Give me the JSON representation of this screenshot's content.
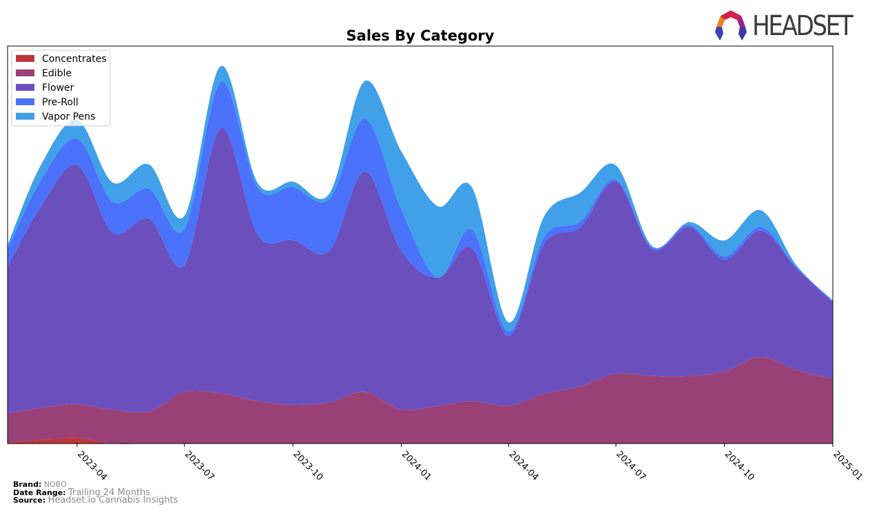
{
  "logo": {
    "text": "HEADSET"
  },
  "footer": {
    "brand_label": "Brand:",
    "brand_value": "NOBO",
    "range_label": "Date Range:",
    "range_value": "Trailing 24 Months",
    "source_label": "Source:",
    "source_value": "Headset.io Cannabis Insights"
  },
  "chart_data": {
    "type": "area",
    "stacked": true,
    "smoothed": true,
    "title": "Sales By Category",
    "xlabel": "",
    "ylabel": "",
    "y_axis_visible": false,
    "ylim": [
      0,
      100
    ],
    "grid": false,
    "legend_position": "top-left",
    "x": [
      "2023-02",
      "2023-03",
      "2023-04",
      "2023-05",
      "2023-06",
      "2023-07",
      "2023-08",
      "2023-09",
      "2023-10",
      "2023-11",
      "2023-12",
      "2024-01",
      "2024-02",
      "2024-03",
      "2024-04",
      "2024-05",
      "2024-06",
      "2024-07",
      "2024-08",
      "2024-09",
      "2024-10",
      "2024-11",
      "2024-12",
      "2025-01"
    ],
    "x_ticks": [
      "2023-04",
      "2023-07",
      "2023-10",
      "2024-01",
      "2024-04",
      "2024-07",
      "2024-10",
      "2025-01"
    ],
    "series": [
      {
        "name": "Concentrates",
        "color": "#c0353a",
        "values": [
          0.2,
          0.9,
          1.4,
          0,
          0,
          0,
          0,
          0,
          0,
          0,
          0,
          0,
          0,
          0,
          0,
          0,
          0,
          0,
          0,
          0,
          0,
          0,
          0,
          0
        ]
      },
      {
        "name": "Edible",
        "color": "#9a4177",
        "values": [
          7.4,
          8.1,
          8.5,
          8.5,
          8.1,
          13.0,
          12.6,
          10.7,
          9.7,
          10.4,
          13.0,
          8.6,
          9.5,
          10.7,
          9.5,
          12.5,
          14.4,
          17.6,
          17.0,
          17.0,
          18.2,
          21.8,
          18.5,
          16.3
        ]
      },
      {
        "name": "Flower",
        "color": "#6a4fbd",
        "values": [
          36.9,
          50.5,
          60.2,
          44.6,
          48.4,
          32.0,
          66.8,
          41.9,
          41.5,
          38.1,
          55.4,
          39.8,
          32.2,
          38.4,
          17.6,
          37.7,
          40.1,
          48.3,
          31.8,
          37.5,
          28.0,
          31.8,
          25.6,
          19.2
        ]
      },
      {
        "name": "Pre-Roll",
        "color": "#4a72fb",
        "values": [
          4.5,
          6.6,
          6.6,
          7.8,
          7.6,
          9.0,
          11.6,
          11.8,
          13.3,
          13.0,
          13.3,
          10.4,
          0,
          4.7,
          1.0,
          1.7,
          1.4,
          0.5,
          0.5,
          0.5,
          0.9,
          0.9,
          0.3,
          0.3
        ]
      },
      {
        "name": "Vapor Pens",
        "color": "#40a0e8",
        "values": [
          0.9,
          3.8,
          4.7,
          4.8,
          6.1,
          3.3,
          4.0,
          1.2,
          1.4,
          1.4,
          9.5,
          14.7,
          18.0,
          10.6,
          2.4,
          5.2,
          7.3,
          3.6,
          0.3,
          0.7,
          4.0,
          4.2,
          0.5,
          0.2
        ]
      }
    ]
  }
}
